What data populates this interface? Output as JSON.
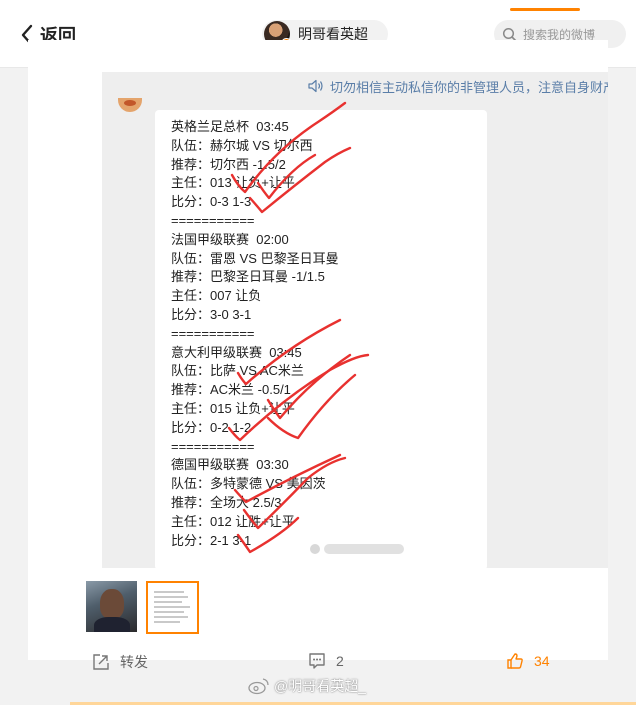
{
  "header": {
    "back_label": "返回",
    "username": "明哥看英超_",
    "search_placeholder": "搜索我的微博",
    "accent_color": "#ff8200"
  },
  "notice": {
    "text": "切勿相信主动私信你的非管理人员，注意自身财产",
    "icon": "speaker-icon"
  },
  "message_lines": [
    "英格兰足总杯  03:45",
    "队伍：赫尔城 VS 切尔西",
    "推荐：切尔西 -1.5/2",
    "主任：013 让负+让平",
    "比分：0-3 1-3",
    "===========",
    "法国甲级联赛  02:00",
    "队伍：雷恩 VS 巴黎圣日耳曼",
    "推荐：巴黎圣日耳曼 -1/1.5",
    "主任：007 让负",
    "比分：3-0 3-1",
    "===========",
    "意大利甲级联赛  03:45",
    "队伍：比萨 VS AC米兰",
    "推荐：AC米兰 -0.5/1",
    "主任：015 让负+让平",
    "比分：0-2 1-2",
    "===========",
    "德国甲级联赛  03:30",
    "队伍：多特蒙德 VS 美因茨",
    "推荐：全场大 2.5/3",
    "主任：012 让胜+让平",
    "比分：2-1 3-1"
  ],
  "annotation_color": "#e8312f",
  "actions": {
    "repost_label": "转发",
    "comment_count": "2",
    "like_count": "34"
  },
  "footer": {
    "watermark": "@明哥看英超_"
  }
}
